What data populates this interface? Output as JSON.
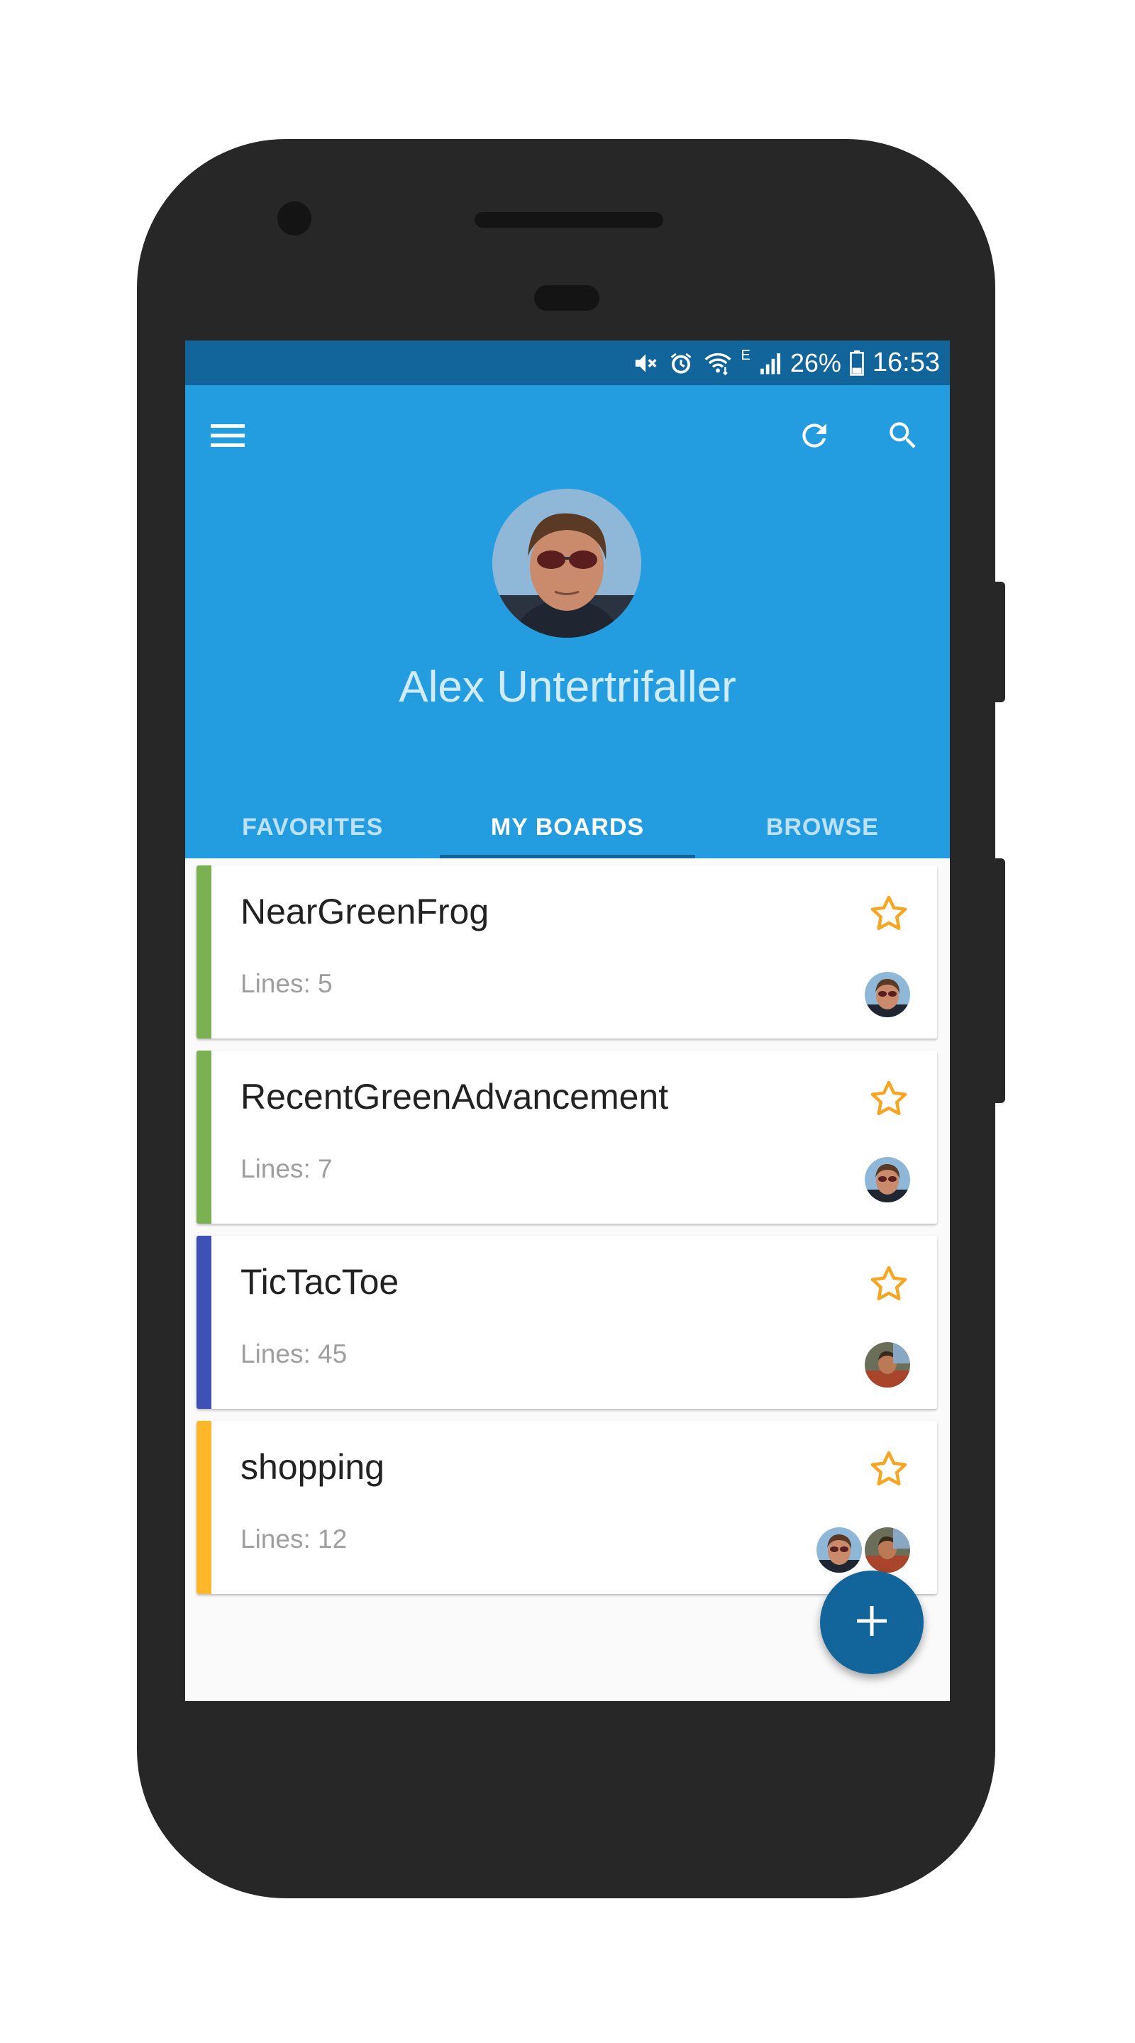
{
  "status_bar": {
    "battery_percent": "26%",
    "time": "16:53",
    "network_type": "E",
    "icons": [
      "mute-icon",
      "alarm-icon",
      "wifi-icon",
      "signal-icon",
      "battery-icon"
    ]
  },
  "toolbar": {
    "menu_icon": "hamburger-menu-icon",
    "refresh_icon": "refresh-icon",
    "search_icon": "search-icon"
  },
  "profile": {
    "name": "Alex Untertrifaller"
  },
  "tabs": [
    {
      "label": "FAVORITES",
      "active": false
    },
    {
      "label": "MY BOARDS",
      "active": true
    },
    {
      "label": "BROWSE",
      "active": false
    }
  ],
  "boards": [
    {
      "title": "NearGreenFrog",
      "lines": "Lines: 5",
      "color": "#7cb153",
      "members": [
        "alex"
      ]
    },
    {
      "title": "RecentGreenAdvancement",
      "lines": "Lines: 7",
      "color": "#7cb153",
      "members": [
        "alex"
      ]
    },
    {
      "title": "TicTacToe",
      "lines": "Lines: 45",
      "color": "#3f51b5",
      "members": [
        "other"
      ]
    },
    {
      "title": "shopping",
      "lines": "Lines: 12",
      "color": "#ffb72a",
      "members": [
        "alex",
        "other"
      ]
    }
  ],
  "fab": {
    "icon": "plus-icon"
  },
  "colors": {
    "primary": "#249de0",
    "primary_dark": "#12659a",
    "star": "#f5a623"
  }
}
